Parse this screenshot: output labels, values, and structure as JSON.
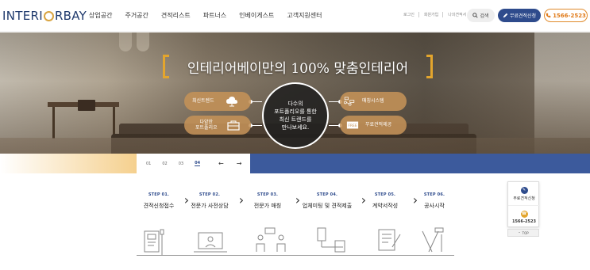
{
  "header": {
    "logo": {
      "pre": "INTERI",
      "post": "RBAY"
    },
    "nav": [
      "상업공간",
      "주거공간",
      "견적리스트",
      "파트너스",
      "인베이게스트",
      "고객지원센터"
    ],
    "util": [
      "로그인",
      "회원가입",
      "나의견적서"
    ],
    "search_label": "검색",
    "quote_label": "무료견적신청",
    "phone_label": "1566-2523"
  },
  "hero": {
    "headline": "인테리어베이만의 100% 맞춤인테리어",
    "center_text": "다수의\n포트폴리오를 통한\n최신 트렌드를\n만나보세요.",
    "pills": {
      "trend": "최신트렌드",
      "portfolio": "다양한\n포트폴리오",
      "matching": "매칭시스템",
      "free_quote": "무료견적제공"
    }
  },
  "pager": {
    "items": [
      "01",
      "02",
      "03",
      "04"
    ],
    "active": "04",
    "prev": "←",
    "next": "→"
  },
  "steps": [
    {
      "no": "STEP 01.",
      "name": "견적신청접수"
    },
    {
      "no": "STEP 02.",
      "name": "전문가 사전상담"
    },
    {
      "no": "STEP 03.",
      "name": "전문가 매칭"
    },
    {
      "no": "STEP 04.",
      "name": "업체미팅 및 견적제출"
    },
    {
      "no": "STEP 05.",
      "name": "계약서작성"
    },
    {
      "no": "STEP 06.",
      "name": "공사시작"
    }
  ],
  "floating": {
    "quote_label": "무료견적신청",
    "phone_label": "1566-2523",
    "top_label": "TOP"
  },
  "colors": {
    "brand_navy": "#2e4b8c",
    "accent_gold": "#e3a52d",
    "phone_orange": "#e07a18"
  }
}
